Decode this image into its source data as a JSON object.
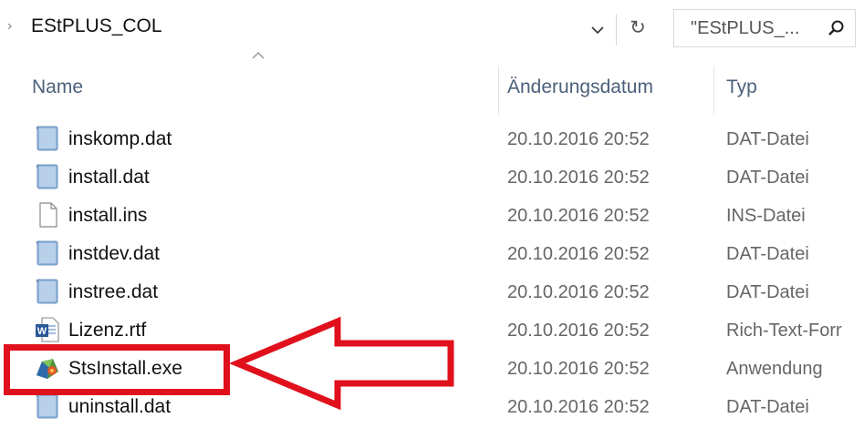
{
  "address": {
    "path": "EStPLUS_COL"
  },
  "search": {
    "placeholder": "\"EStPLUS_..."
  },
  "columns": {
    "name": "Name",
    "date": "Änderungsdatum",
    "type": "Typ"
  },
  "files": [
    {
      "name": "inskomp.dat",
      "date": "20.10.2016 20:52",
      "type": "DAT-Datei",
      "icon": "dat-file-icon"
    },
    {
      "name": "install.dat",
      "date": "20.10.2016 20:52",
      "type": "DAT-Datei",
      "icon": "dat-file-icon"
    },
    {
      "name": "install.ins",
      "date": "20.10.2016 20:52",
      "type": "INS-Datei",
      "icon": "blank-file-icon"
    },
    {
      "name": "instdev.dat",
      "date": "20.10.2016 20:52",
      "type": "DAT-Datei",
      "icon": "dat-file-icon"
    },
    {
      "name": "instree.dat",
      "date": "20.10.2016 20:52",
      "type": "DAT-Datei",
      "icon": "dat-file-icon"
    },
    {
      "name": "Lizenz.rtf",
      "date": "20.10.2016 20:52",
      "type": "Rich-Text-Forr",
      "icon": "word-document-icon"
    },
    {
      "name": "StsInstall.exe",
      "date": "20.10.2016 20:52",
      "type": "Anwendung",
      "icon": "installer-app-icon"
    },
    {
      "name": "uninstall.dat",
      "date": "20.10.2016 20:52",
      "type": "DAT-Datei",
      "icon": "dat-file-icon"
    }
  ],
  "colors": {
    "highlight": "#e0101c",
    "header_text": "#4c607a"
  }
}
